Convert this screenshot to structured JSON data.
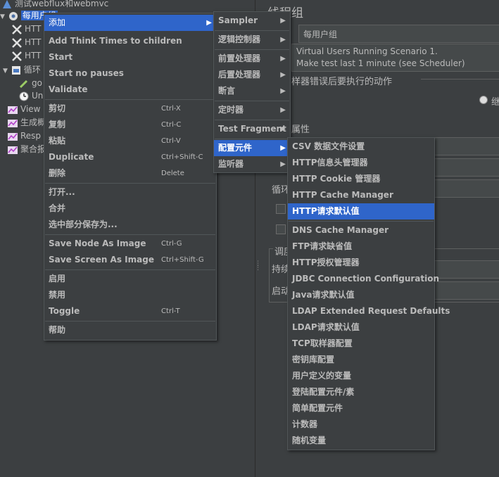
{
  "tree": {
    "items": [
      {
        "label": "测试webflux和webmvc"
      },
      {
        "label": "每用户组"
      },
      {
        "label": "HTT"
      },
      {
        "label": "HTT"
      },
      {
        "label": "HTT"
      },
      {
        "label": "循环"
      },
      {
        "label": "go"
      },
      {
        "label": "Un"
      },
      {
        "label": "View"
      },
      {
        "label": "生成概"
      },
      {
        "label": "Resp"
      },
      {
        "label": "聚合报"
      }
    ]
  },
  "panel": {
    "title": "线程组",
    "name_value": "每用户组",
    "comment_line1": "Virtual Users Running Scenario 1.",
    "comment_line2": "Make test last 1 minute (see Scheduler)",
    "section_error": "样器错误后要执行的动作",
    "radio_label": "继",
    "section_props": "属性",
    "loop_label": "循环",
    "scheduler_label": "调度",
    "duration_label": "持续",
    "startup_label": "启动"
  },
  "context_menu": {
    "add": "添加",
    "add_think": "Add Think Times to children",
    "start": "Start",
    "start_no_pauses": "Start no pauses",
    "validate": "Validate",
    "cut": "剪切",
    "cut_sc": "Ctrl-X",
    "copy": "复制",
    "copy_sc": "Ctrl-C",
    "paste": "粘贴",
    "paste_sc": "Ctrl-V",
    "duplicate": "Duplicate",
    "duplicate_sc": "Ctrl+Shift-C",
    "delete": "删除",
    "delete_sc": "Delete",
    "open": "打开...",
    "merge": "合并",
    "save_selection": "选中部分保存为...",
    "save_node_image": "Save Node As Image",
    "save_node_image_sc": "Ctrl-G",
    "save_screen_image": "Save Screen As Image",
    "save_screen_image_sc": "Ctrl+Shift-G",
    "enable": "启用",
    "disable": "禁用",
    "toggle": "Toggle",
    "toggle_sc": "Ctrl-T",
    "help": "帮助"
  },
  "add_submenu": {
    "sampler": "Sampler",
    "logic_controller": "逻辑控制器",
    "pre_processor": "前置处理器",
    "post_processor": "后置处理器",
    "assertion": "断言",
    "timer": "定时器",
    "test_fragment": "Test Fragment",
    "config_element": "配置元件",
    "listener": "监听器"
  },
  "config_submenu": {
    "items": [
      "CSV 数据文件设置",
      "HTTP信息头管理器",
      "HTTP Cookie 管理器",
      "HTTP Cache Manager",
      "HTTP请求默认值",
      "DNS Cache Manager",
      "FTP请求缺省值",
      "HTTP授权管理器",
      "JDBC Connection Configuration",
      "Java请求默认值",
      "LDAP Extended Request Defaults",
      "LDAP请求默认值",
      "TCP取样器配置",
      "密钥库配置",
      "用户定义的变量",
      "登陆配置元件/素",
      "简单配置元件",
      "计数器",
      "随机变量"
    ]
  },
  "colors": {
    "background": "#3c3f41",
    "highlight": "#2f65ca",
    "text": "#bbbbbb"
  }
}
